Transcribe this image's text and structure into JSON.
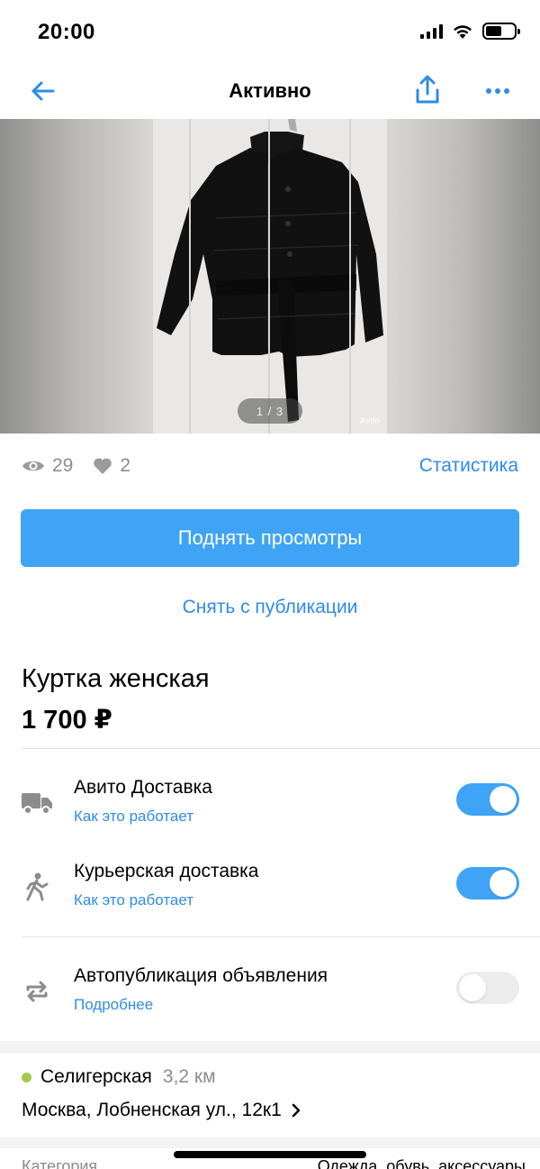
{
  "status_bar": {
    "time": "20:00"
  },
  "navbar": {
    "title": "Активно"
  },
  "gallery": {
    "counter": "1 / 3",
    "watermark": "Avito"
  },
  "stats": {
    "views": "29",
    "likes": "2",
    "statistics_link": "Статистика"
  },
  "actions": {
    "promote_button": "Поднять просмотры",
    "unpublish_link": "Снять с публикации"
  },
  "item": {
    "title": "Куртка женская",
    "price": "1 700 ₽"
  },
  "options": [
    {
      "title": "Авито Доставка",
      "link": "Как это работает",
      "enabled": true,
      "icon": "truck-icon"
    },
    {
      "title": "Курьерская доставка",
      "link": "Как это работает",
      "enabled": true,
      "icon": "courier-icon"
    },
    {
      "title": "Автопубликация объявления",
      "link": "Подробнее",
      "enabled": false,
      "icon": "repeat-icon"
    }
  ],
  "location": {
    "metro": "Селигерская",
    "distance": "3,2 км",
    "address": "Москва, Лобненская ул., 12к1"
  },
  "details_cut": {
    "label": "Категория",
    "value": "Одежда, обувь, аксессуары"
  },
  "colors": {
    "accent": "#2f8ce6",
    "button": "#3fa4f5",
    "metro_line": "#a5c94c"
  }
}
